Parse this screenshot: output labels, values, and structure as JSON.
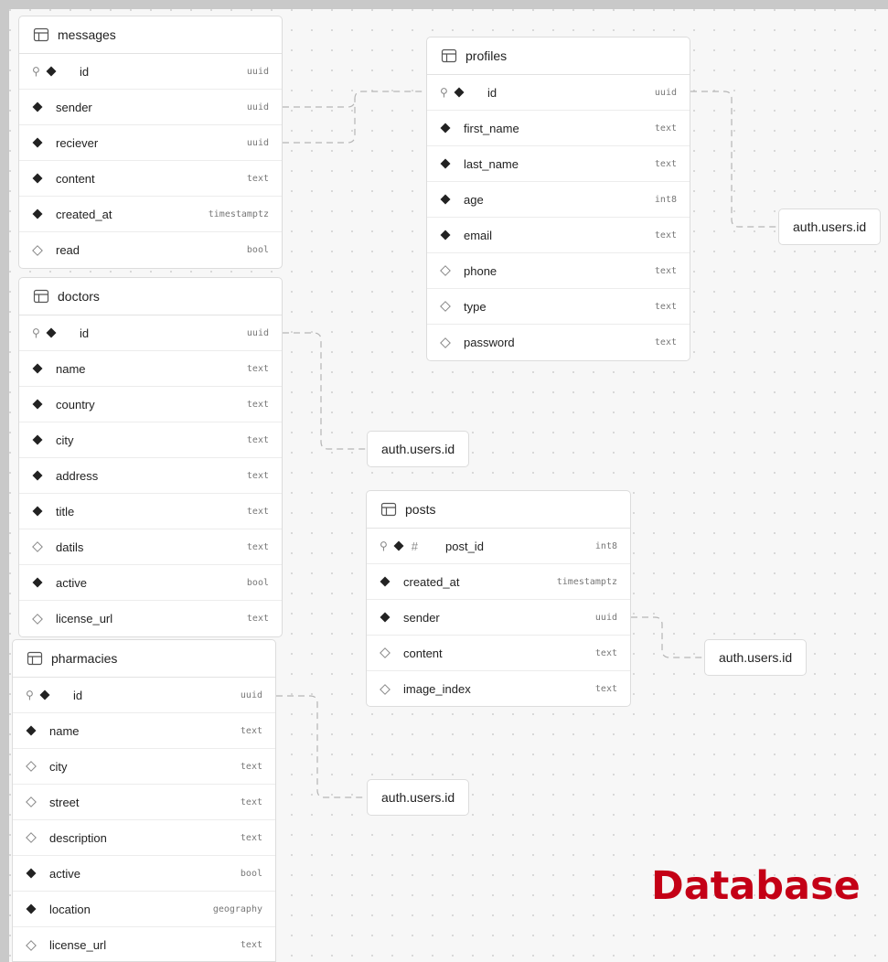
{
  "tables": {
    "messages": {
      "name": "messages",
      "columns": [
        {
          "name": "id",
          "type": "uuid",
          "pk": true,
          "nullable": false
        },
        {
          "name": "sender",
          "type": "uuid",
          "nullable": false
        },
        {
          "name": "reciever",
          "type": "uuid",
          "nullable": false
        },
        {
          "name": "content",
          "type": "text",
          "nullable": false
        },
        {
          "name": "created_at",
          "type": "timestamptz",
          "nullable": false
        },
        {
          "name": "read",
          "type": "bool",
          "nullable": true
        }
      ]
    },
    "profiles": {
      "name": "profiles",
      "columns": [
        {
          "name": "id",
          "type": "uuid",
          "pk": true,
          "nullable": false
        },
        {
          "name": "first_name",
          "type": "text",
          "nullable": false
        },
        {
          "name": "last_name",
          "type": "text",
          "nullable": false
        },
        {
          "name": "age",
          "type": "int8",
          "nullable": false
        },
        {
          "name": "email",
          "type": "text",
          "nullable": false
        },
        {
          "name": "phone",
          "type": "text",
          "nullable": true
        },
        {
          "name": "type",
          "type": "text",
          "nullable": true
        },
        {
          "name": "password",
          "type": "text",
          "nullable": true
        }
      ]
    },
    "doctors": {
      "name": "doctors",
      "columns": [
        {
          "name": "id",
          "type": "uuid",
          "pk": true,
          "nullable": false
        },
        {
          "name": "name",
          "type": "text",
          "nullable": false
        },
        {
          "name": "country",
          "type": "text",
          "nullable": false
        },
        {
          "name": "city",
          "type": "text",
          "nullable": false
        },
        {
          "name": "address",
          "type": "text",
          "nullable": false
        },
        {
          "name": "title",
          "type": "text",
          "nullable": false
        },
        {
          "name": "datils",
          "type": "text",
          "nullable": true
        },
        {
          "name": "active",
          "type": "bool",
          "nullable": false
        },
        {
          "name": "license_url",
          "type": "text",
          "nullable": true
        }
      ]
    },
    "posts": {
      "name": "posts",
      "columns": [
        {
          "name": "post_id",
          "type": "int8",
          "pk": true,
          "nullable": false,
          "identity": true
        },
        {
          "name": "created_at",
          "type": "timestamptz",
          "nullable": false
        },
        {
          "name": "sender",
          "type": "uuid",
          "nullable": false
        },
        {
          "name": "content",
          "type": "text",
          "nullable": true
        },
        {
          "name": "image_index",
          "type": "text",
          "nullable": true
        }
      ]
    },
    "pharmacies": {
      "name": "pharmacies",
      "columns": [
        {
          "name": "id",
          "type": "uuid",
          "pk": true,
          "nullable": false
        },
        {
          "name": "name",
          "type": "text",
          "nullable": false
        },
        {
          "name": "city",
          "type": "text",
          "nullable": true
        },
        {
          "name": "street",
          "type": "text",
          "nullable": true
        },
        {
          "name": "description",
          "type": "text",
          "nullable": true
        },
        {
          "name": "active",
          "type": "bool",
          "nullable": false
        },
        {
          "name": "location",
          "type": "geography",
          "nullable": false
        },
        {
          "name": "license_url",
          "type": "text",
          "nullable": true
        }
      ]
    }
  },
  "references": {
    "profiles_auth": "auth.users.id",
    "doctors_auth": "auth.users.id",
    "posts_auth": "auth.users.id",
    "pharmacies_auth": "auth.users.id"
  },
  "caption": "Database",
  "colors": {
    "caption": "#c40016",
    "canvas": "#f7f7f7",
    "connector": "#b5b5b5"
  }
}
